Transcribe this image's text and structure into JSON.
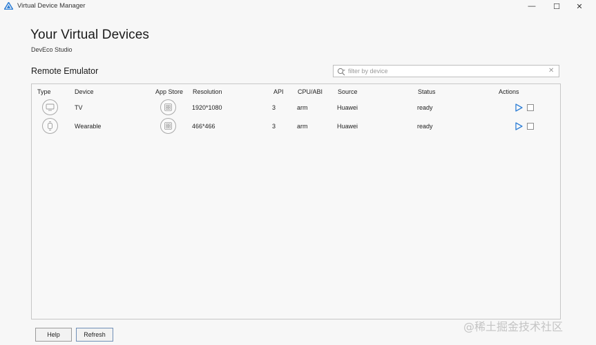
{
  "window": {
    "title": "Virtual Device Manager",
    "minimize": "—",
    "maximize": "☐",
    "close": "✕"
  },
  "header": {
    "title": "Your Virtual Devices",
    "subtitle": "DevEco Studio"
  },
  "section": {
    "title": "Remote Emulator"
  },
  "search": {
    "placeholder": "filter by device",
    "value": "",
    "clear": "✕"
  },
  "table": {
    "columns": [
      "Type",
      "Device",
      "App Store",
      "Resolution",
      "API",
      "CPU/ABI",
      "Source",
      "Status",
      "Actions"
    ],
    "rows": [
      {
        "type_icon": "tv-icon",
        "device": "TV",
        "app_store_icon": "app-store-icon",
        "resolution": "1920*1080",
        "api": "3",
        "cpu": "arm",
        "source": "Huawei",
        "status": "ready"
      },
      {
        "type_icon": "watch-icon",
        "device": "Wearable",
        "app_store_icon": "app-store-icon",
        "resolution": "466*466",
        "api": "3",
        "cpu": "arm",
        "source": "Huawei",
        "status": "ready"
      }
    ]
  },
  "footer": {
    "help_label": "Help",
    "refresh_label": "Refresh"
  },
  "watermark": "@稀土掘金技术社区",
  "colors": {
    "accent": "#2f7fd6",
    "border": "#c6c6c6",
    "background": "#f7f7f7"
  }
}
